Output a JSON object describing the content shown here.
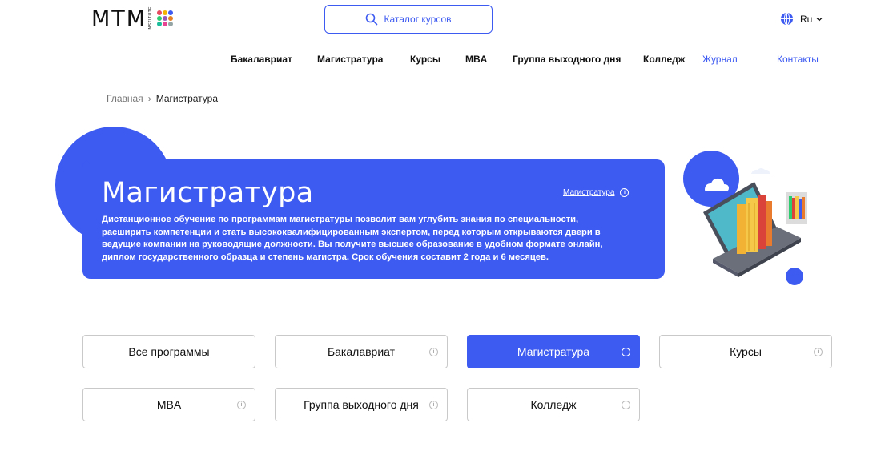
{
  "header": {
    "logo_text": "MTM",
    "logo_sub": "INSTITUTE",
    "logo_dot_colors": [
      "#e84a5f",
      "#f4b400",
      "#3d5af1",
      "#2ecc71",
      "#9b59b6",
      "#e67e22",
      "#1abc9c",
      "#e84393",
      "#95a5a6"
    ],
    "catalog_label": "Каталог курсов",
    "language": "Ru"
  },
  "nav": {
    "items": [
      {
        "label": "Бакалавриат"
      },
      {
        "label": "Магистратура"
      },
      {
        "label": "Курсы"
      },
      {
        "label": "MBA"
      },
      {
        "label": "Группа выходного дня"
      },
      {
        "label": "Колледж"
      },
      {
        "label": "Журнал"
      },
      {
        "label": "Контакты"
      }
    ]
  },
  "breadcrumb": {
    "home": "Главная",
    "separator": "›",
    "current": "Магистратура"
  },
  "hero": {
    "title": "Магистратура",
    "link_label": "Магистратура",
    "description": "Дистанционное обучение по программам магистратуры позволит вам углубить знания по специальности, расширить компетенции и стать высококвалифицированным экспертом, перед которым открываются двери в ведущие компании на руководящие должности. Вы получите высшее образование в удобном формате онлайн, диплом государственного образца и степень магистра. Срок обучения составит 2 года и 6 месяцев."
  },
  "filters": {
    "items": [
      {
        "label": "Все программы"
      },
      {
        "label": "Бакалавриат"
      },
      {
        "label": "Магистратура"
      },
      {
        "label": "Курсы"
      },
      {
        "label": "MBA"
      },
      {
        "label": "Группа выходного дня"
      },
      {
        "label": "Колледж"
      }
    ],
    "active": "Магистратура"
  },
  "colors": {
    "accent": "#3d5af1",
    "text": "#111111",
    "border": "#c9c9c9"
  },
  "icons": {
    "search": "search-icon",
    "globe": "globe-icon",
    "chevron": "chevron-down-icon",
    "info": "info-icon"
  }
}
